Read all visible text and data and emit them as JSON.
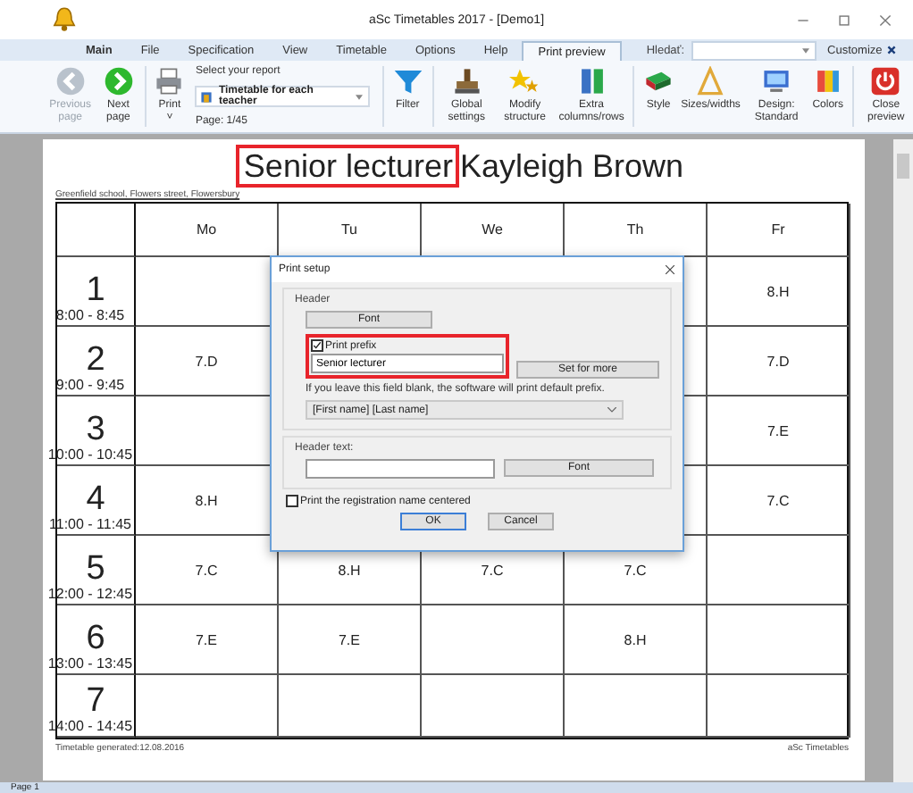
{
  "window": {
    "title": "aSc Timetables 2017  - [Demo1]"
  },
  "tabs": [
    {
      "label": "Main",
      "selected": false,
      "bold": true
    },
    {
      "label": "File",
      "selected": false,
      "bold": false
    },
    {
      "label": "Specification",
      "selected": false,
      "bold": false
    },
    {
      "label": "View",
      "selected": false,
      "bold": false
    },
    {
      "label": "Timetable",
      "selected": false,
      "bold": false
    },
    {
      "label": "Options",
      "selected": false,
      "bold": false
    },
    {
      "label": "Help",
      "selected": false,
      "bold": false
    },
    {
      "label": "Print preview",
      "selected": true,
      "bold": false
    }
  ],
  "search": {
    "label": "Hledať:"
  },
  "customize": "Customize",
  "ribbon": {
    "nav": [
      {
        "label": "Previous page",
        "disabled": true
      },
      {
        "label": "Next page",
        "disabled": false
      }
    ],
    "print": {
      "label": "Print",
      "caret": "˅"
    },
    "report": {
      "heading": "Select your report",
      "value": "Timetable for each teacher",
      "page": "Page: 1/45"
    },
    "tools": [
      {
        "label": "Filter",
        "disabled": false
      },
      {
        "label": "Global settings",
        "disabled": false
      },
      {
        "label": "Modify structure",
        "disabled": false
      },
      {
        "label": "Extra columns/rows",
        "disabled": false
      },
      {
        "label": "Style",
        "disabled": false
      },
      {
        "label": "Sizes/widths",
        "disabled": false
      },
      {
        "label": "Design: Standard",
        "disabled": false
      },
      {
        "label": "Colors",
        "disabled": false
      },
      {
        "label": "Close preview",
        "disabled": false
      }
    ]
  },
  "page": {
    "title_prefix": "Senior lecturer",
    "title_name": "Kayleigh Brown",
    "school": "Greenfield school, Flowers street, Flowersbury",
    "days": [
      "Mo",
      "Tu",
      "We",
      "Th",
      "Fr"
    ],
    "periods": [
      {
        "number": "1",
        "time": "8:00 - 8:45",
        "cells": [
          null,
          null,
          null,
          null,
          "8.H"
        ]
      },
      {
        "number": "2",
        "time": "9:00 - 9:45",
        "cells": [
          "7.D",
          null,
          null,
          null,
          "7.D"
        ]
      },
      {
        "number": "3",
        "time": "10:00 - 10:45",
        "cells": [
          null,
          null,
          null,
          null,
          "7.E"
        ]
      },
      {
        "number": "4",
        "time": "11:00 - 11:45",
        "cells": [
          "8.H",
          null,
          null,
          null,
          "7.C"
        ]
      },
      {
        "number": "5",
        "time": "12:00 - 12:45",
        "cells": [
          "7.C",
          "8.H",
          "7.C",
          "7.C",
          null
        ]
      },
      {
        "number": "6",
        "time": "13:00 - 13:45",
        "cells": [
          "7.E",
          "7.E",
          null,
          "8.H",
          null
        ]
      },
      {
        "number": "7",
        "time": "14:00 - 14:45",
        "cells": [
          null,
          null,
          null,
          null,
          null
        ]
      }
    ],
    "generated": "Timetable generated:12.08.2016",
    "brand": "aSc Timetables"
  },
  "dialog": {
    "title": "Print setup",
    "header_group": "Header",
    "font_button": "Font",
    "prefix": {
      "label": "Print prefix",
      "checked": true,
      "value": "Senior lecturer"
    },
    "set_for_more": "Set for more",
    "hint": "If you leave this field blank, the software will print default prefix.",
    "name_format": "[First name] [Last name]",
    "header_text_label": "Header text:",
    "header_font_button": "Font",
    "centered": {
      "label": "Print the registration name centered",
      "checked": false
    },
    "ok": "OK",
    "cancel": "Cancel"
  },
  "status_bar": {
    "page": "Page 1"
  }
}
